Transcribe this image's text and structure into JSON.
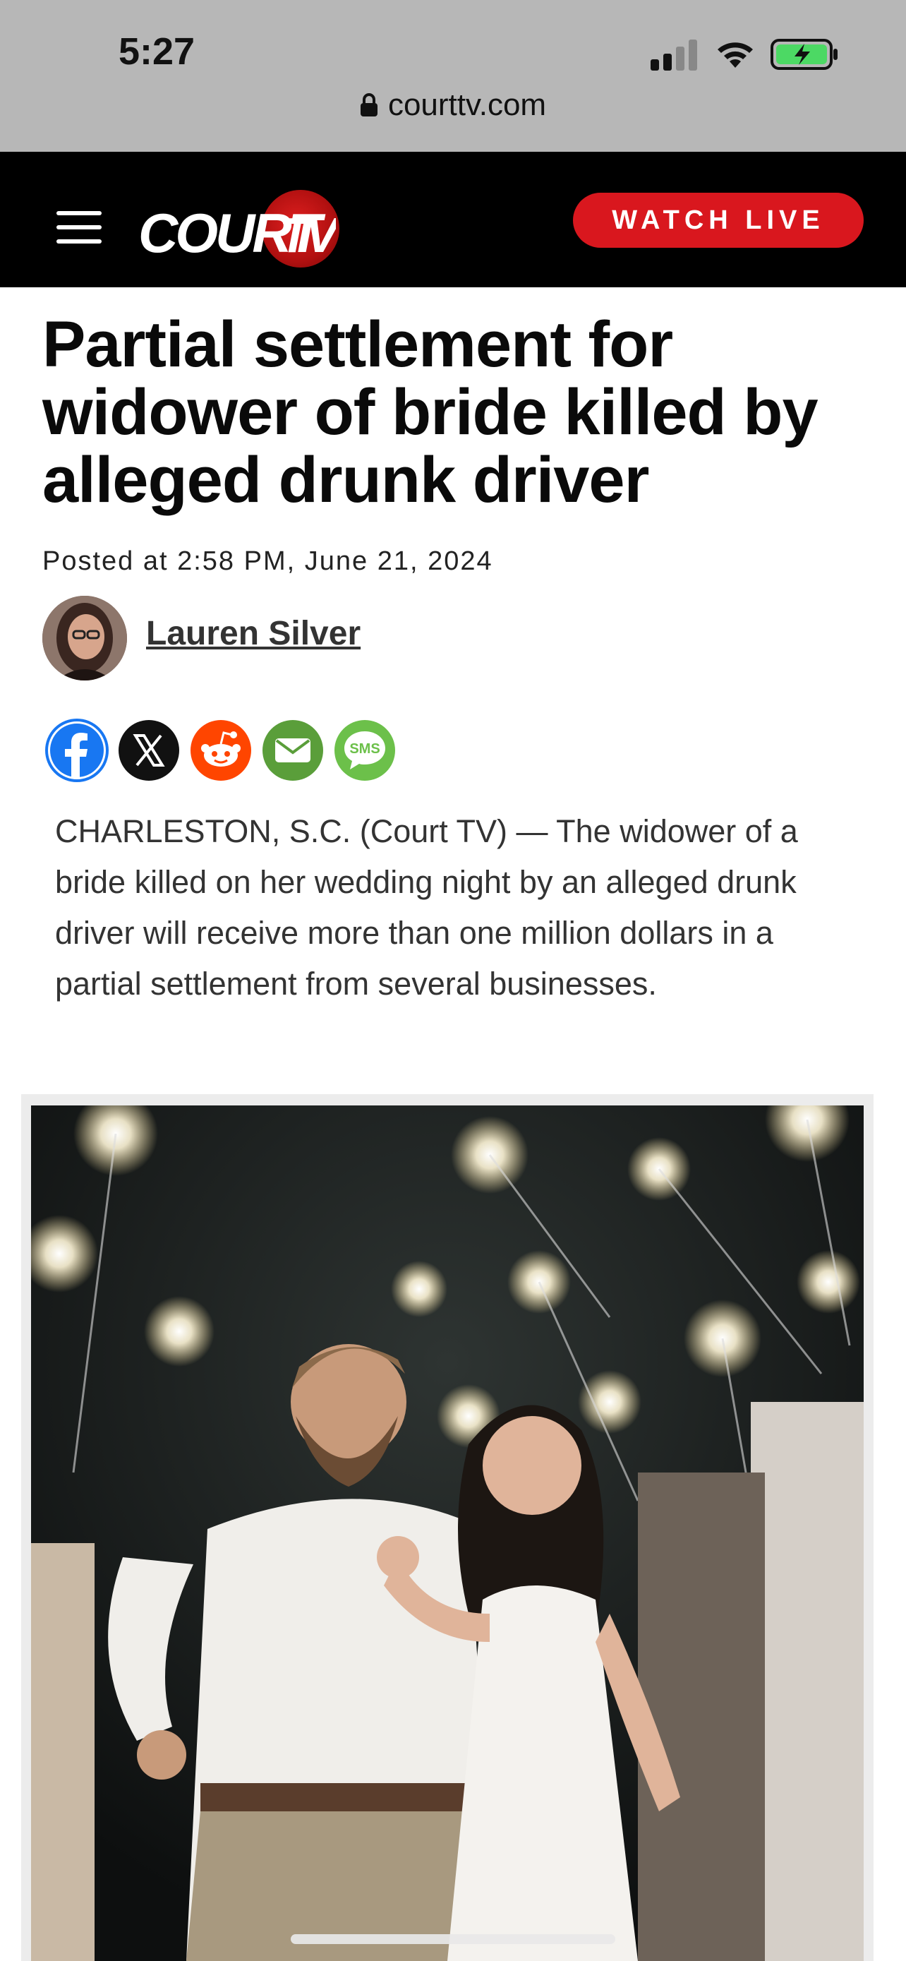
{
  "status_bar": {
    "time": "5:27"
  },
  "browser": {
    "url": "courttv.com"
  },
  "nav": {
    "logo_text": "COURT",
    "watch_live": "WATCH LIVE"
  },
  "article": {
    "headline": "Partial settlement for widower of bride killed by alleged drunk driver",
    "posted": "Posted at 2:58 PM, June 21, 2024",
    "author": "Lauren Silver",
    "body": "CHARLESTON, S.C. (Court TV) — The widower of a bride killed on her wedding night by an alleged drunk driver will receive more than one million dollars in a partial settlement from several businesses.",
    "share": [
      {
        "name": "facebook",
        "color": "#1877f2"
      },
      {
        "name": "x",
        "color": "#000000"
      },
      {
        "name": "reddit",
        "color": "#ff4500"
      },
      {
        "name": "email",
        "color": "#5a9e3a"
      },
      {
        "name": "sms",
        "color": "#6cc04a",
        "label": "SMS"
      }
    ]
  },
  "colors": {
    "brand_red": "#d9171e",
    "nav_bg": "#000000"
  }
}
